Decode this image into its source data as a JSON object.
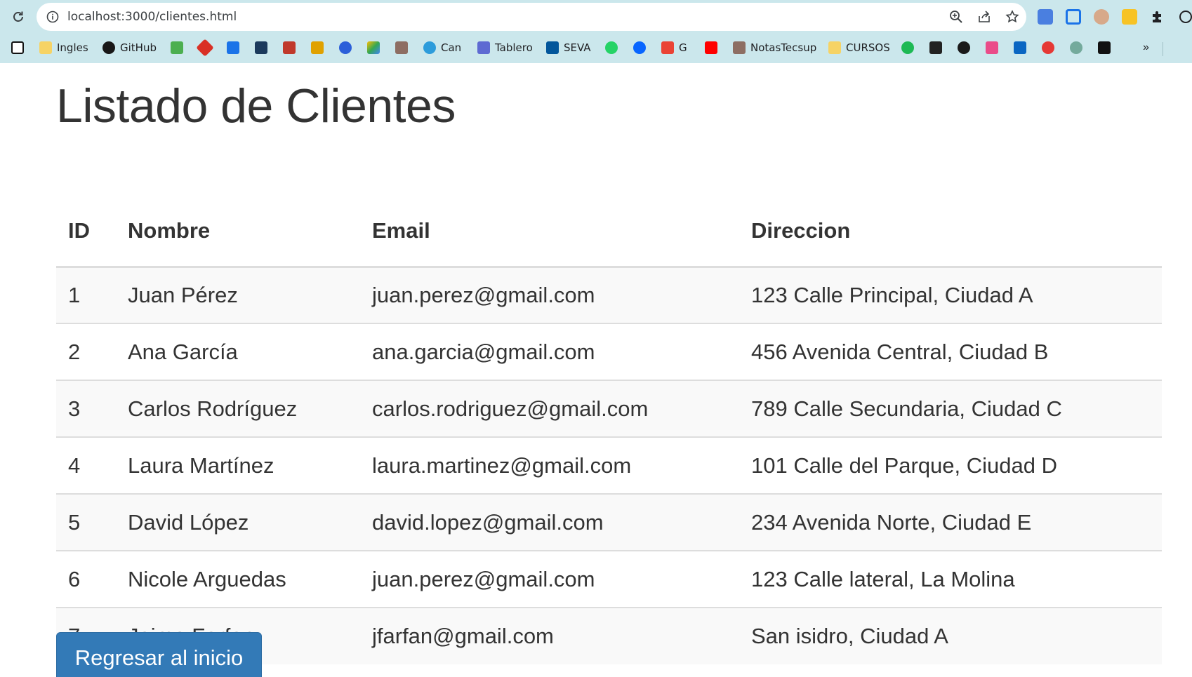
{
  "browser": {
    "url": "localhost:3000/clientes.html",
    "bookmarks": [
      {
        "label": "",
        "icon": "notion-icon",
        "color": "#111111"
      },
      {
        "label": "Ingles",
        "icon": "folder-icon",
        "color": "#f6d365"
      },
      {
        "label": "GitHub",
        "icon": "github-icon",
        "color": "#181717"
      },
      {
        "label": "",
        "icon": "bookmark-icon",
        "color": "#4caf50"
      },
      {
        "label": "",
        "icon": "bookmark-icon",
        "color": "#d93025"
      },
      {
        "label": "",
        "icon": "calendar-icon",
        "color": "#1a73e8"
      },
      {
        "label": "",
        "icon": "bookmark-icon",
        "color": "#1b3a5c"
      },
      {
        "label": "",
        "icon": "bookmark-icon",
        "color": "#c0392b"
      },
      {
        "label": "",
        "icon": "bookmark-icon",
        "color": "#e0a100"
      },
      {
        "label": "",
        "icon": "bookmark-icon",
        "color": "#2b5fd9"
      },
      {
        "label": "",
        "icon": "drive-icon",
        "color": "#34a853"
      },
      {
        "label": "",
        "icon": "bookmark-icon",
        "color": "#8d6e63"
      },
      {
        "label": "Can",
        "icon": "canva-icon",
        "color": "#2d9cdb"
      },
      {
        "label": "Tablero",
        "icon": "bookmark-icon",
        "color": "#5e6ad2"
      },
      {
        "label": "SEVA",
        "icon": "flutter-icon",
        "color": "#02569b"
      },
      {
        "label": "",
        "icon": "whatsapp-icon",
        "color": "#25d366"
      },
      {
        "label": "",
        "icon": "meta-icon",
        "color": "#0866ff"
      },
      {
        "label": "G",
        "icon": "gmail-icon",
        "color": "#ea4335"
      },
      {
        "label": "",
        "icon": "youtube-icon",
        "color": "#ff0000"
      },
      {
        "label": "NotasTecsup",
        "icon": "bookmark-icon",
        "color": "#8d6e63"
      },
      {
        "label": "CURSOS",
        "icon": "folder-icon",
        "color": "#f6d365"
      },
      {
        "label": "",
        "icon": "bookmark-icon",
        "color": "#1db954"
      },
      {
        "label": "",
        "icon": "bookmark-icon",
        "color": "#222222"
      },
      {
        "label": "",
        "icon": "bookmark-icon",
        "color": "#1a1a1a"
      },
      {
        "label": "",
        "icon": "bookmark-icon",
        "color": "#ea4c89"
      },
      {
        "label": "",
        "icon": "linkedin-icon",
        "color": "#0a66c2"
      },
      {
        "label": "",
        "icon": "bookmark-icon",
        "color": "#e53935"
      },
      {
        "label": "",
        "icon": "chatgpt-icon",
        "color": "#74aa9c"
      },
      {
        "label": "",
        "icon": "bookmark-icon",
        "color": "#111111"
      }
    ],
    "more_label": "»"
  },
  "page": {
    "title": "Listado de Clientes",
    "headers": {
      "id": "ID",
      "nombre": "Nombre",
      "email": "Email",
      "direccion": "Direccion"
    },
    "rows": [
      {
        "id": "1",
        "nombre": "Juan Pérez",
        "email": "juan.perez@gmail.com",
        "direccion": "123 Calle Principal, Ciudad A"
      },
      {
        "id": "2",
        "nombre": "Ana García",
        "email": "ana.garcia@gmail.com",
        "direccion": "456 Avenida Central, Ciudad B"
      },
      {
        "id": "3",
        "nombre": "Carlos Rodríguez",
        "email": "carlos.rodriguez@gmail.com",
        "direccion": "789 Calle Secundaria, Ciudad C"
      },
      {
        "id": "4",
        "nombre": "Laura Martínez",
        "email": "laura.martinez@gmail.com",
        "direccion": "101 Calle del Parque, Ciudad D"
      },
      {
        "id": "5",
        "nombre": "David López",
        "email": "david.lopez@gmail.com",
        "direccion": "234 Avenida Norte, Ciudad E"
      },
      {
        "id": "6",
        "nombre": "Nicole Arguedas",
        "email": "juan.perez@gmail.com",
        "direccion": "123 Calle lateral, La Molina"
      },
      {
        "id": "7",
        "nombre": "Jaime Farfan",
        "email": "jfarfan@gmail.com",
        "direccion": "San isidro, Ciudad A"
      }
    ],
    "back_button": "Regresar al inicio"
  }
}
